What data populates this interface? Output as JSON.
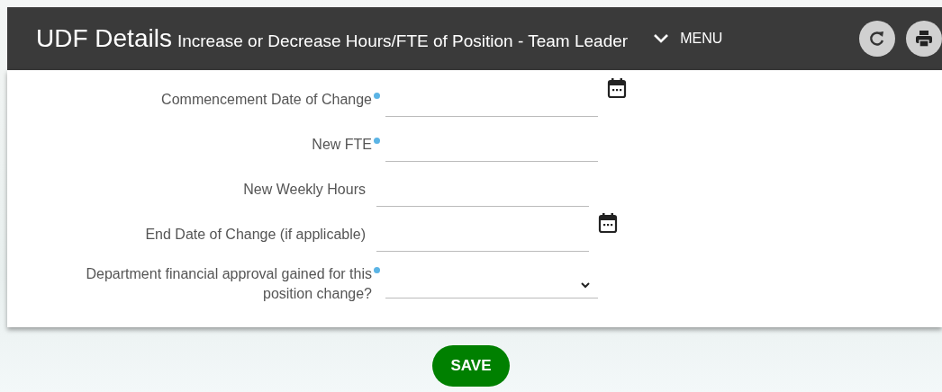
{
  "header": {
    "title": "UDF Details",
    "subtitle": "Increase or Decrease Hours/FTE of Position - Team Leader",
    "menu_label": "MENU"
  },
  "fields": [
    {
      "label": "Commencement Date of Change",
      "required": true,
      "kind": "date"
    },
    {
      "label": "New FTE",
      "required": true,
      "kind": "text"
    },
    {
      "label": "New Weekly Hours",
      "required": false,
      "kind": "text"
    },
    {
      "label": "End Date of Change (if applicable)",
      "required": false,
      "kind": "date"
    },
    {
      "label": "Department financial approval gained for this position change?",
      "required": true,
      "kind": "select"
    }
  ],
  "save_button": "SAVE"
}
